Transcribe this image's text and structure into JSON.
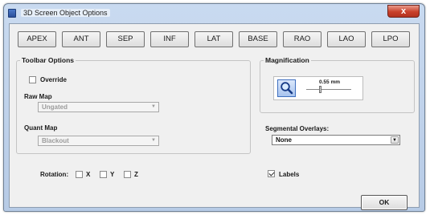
{
  "window": {
    "title": "3D Screen Object Options",
    "close_glyph": "x"
  },
  "view_buttons": [
    "APEX",
    "ANT",
    "SEP",
    "INF",
    "LAT",
    "BASE",
    "RAO",
    "LAO",
    "LPO"
  ],
  "toolbar_options": {
    "label": "Toolbar Options",
    "override_label": "Override",
    "override_checked": false,
    "raw_map_label": "Raw Map",
    "raw_map_value": "Ungated",
    "quant_map_label": "Quant Map",
    "quant_map_value": "Blackout"
  },
  "rotation": {
    "label": "Rotation:",
    "axes": [
      {
        "label": "X",
        "checked": false
      },
      {
        "label": "Y",
        "checked": false
      },
      {
        "label": "Z",
        "checked": false
      }
    ]
  },
  "magnification": {
    "label": "Magnification",
    "value_text": "0.55 mm",
    "icon": "zoom-magnifier-icon"
  },
  "segmental_overlays": {
    "label": "Segmental Overlays:",
    "value": "None"
  },
  "labels_checkbox": {
    "label": "Labels",
    "checked": true
  },
  "ok_label": "OK"
}
